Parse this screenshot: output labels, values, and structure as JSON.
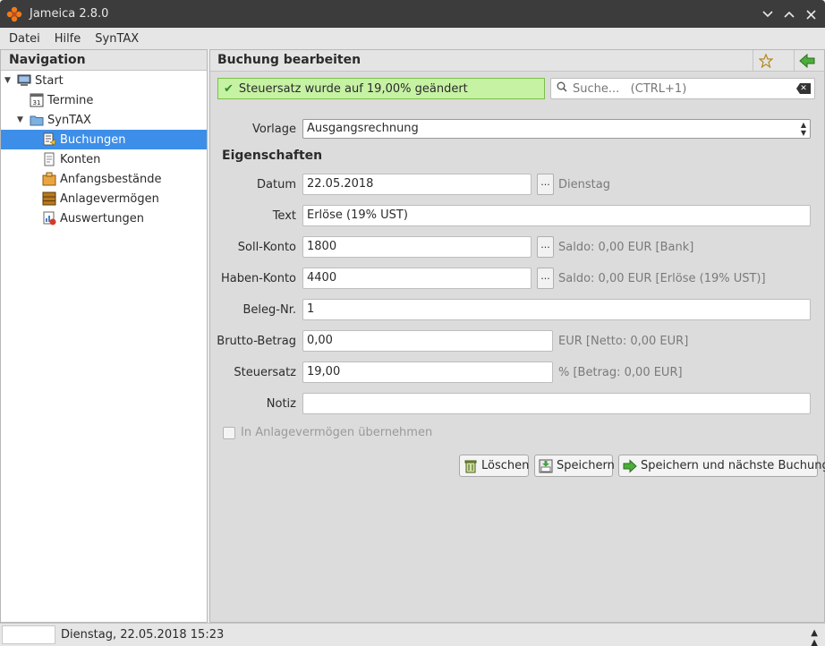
{
  "window": {
    "title": "Jameica 2.8.0"
  },
  "menu": [
    "Datei",
    "Hilfe",
    "SynTAX"
  ],
  "navigation": {
    "header": "Navigation",
    "items": [
      {
        "label": "Start",
        "icon": "computer-icon"
      },
      {
        "label": "Termine",
        "icon": "calendar-icon",
        "icon_text": "31"
      },
      {
        "label": "SynTAX",
        "icon": "folder-icon"
      },
      {
        "label": "Buchungen",
        "icon": "booking-icon",
        "selected": true
      },
      {
        "label": "Konten",
        "icon": "document-icon"
      },
      {
        "label": "Anfangsbestände",
        "icon": "box-icon"
      },
      {
        "label": "Anlagevermögen",
        "icon": "cabinet-icon"
      },
      {
        "label": "Auswertungen",
        "icon": "chart-icon"
      }
    ]
  },
  "content": {
    "header": "Buchung bearbeiten",
    "notice": "Steuersatz wurde auf 19,00% geändert",
    "search_placeholder": "Suche...   (CTRL+1)",
    "vorlage": {
      "label": "Vorlage",
      "value": "Ausgangsrechnung"
    },
    "section_title": "Eigenschaften",
    "fields": {
      "datum": {
        "label": "Datum",
        "value": "22.05.2018",
        "hint": "Dienstag"
      },
      "text": {
        "label": "Text",
        "value": "Erlöse (19% UST)"
      },
      "soll": {
        "label": "Soll-Konto",
        "value": "1800",
        "hint": "Saldo: 0,00 EUR [Bank]"
      },
      "haben": {
        "label": "Haben-Konto",
        "value": "4400",
        "hint": "Saldo: 0,00 EUR [Erlöse (19% UST)]"
      },
      "beleg": {
        "label": "Beleg-Nr.",
        "value": "1"
      },
      "brutto": {
        "label": "Brutto-Betrag",
        "value": "0,00",
        "hint": "EUR [Netto: 0,00 EUR]"
      },
      "steuersatz": {
        "label": "Steuersatz",
        "value": "19,00",
        "hint": "% [Betrag: 0,00 EUR]"
      },
      "notiz": {
        "label": "Notiz",
        "value": ""
      }
    },
    "dots_label": "...",
    "checkbox_label": "In Anlagevermögen übernehmen",
    "buttons": {
      "delete": "Löschen",
      "save": "Speichern",
      "save_next": "Speichern und nächste Buchung"
    }
  },
  "status": {
    "text": "Dienstag, 22.05.2018 15:23"
  },
  "colors": {
    "selection": "#3d8ee8",
    "notice_bg": "#c6f2a4",
    "titlebar": "#3c3c3c"
  }
}
